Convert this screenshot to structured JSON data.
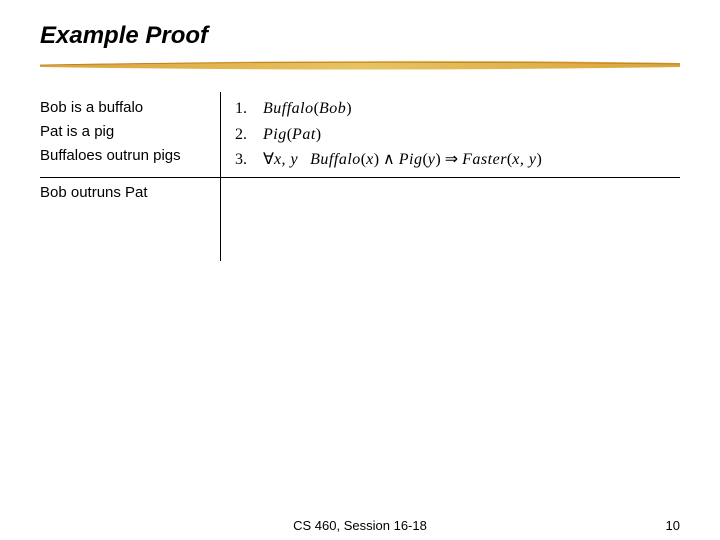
{
  "title": "Example Proof",
  "premises_text": [
    "Bob is a buffalo",
    "Pat is a pig",
    "Buffaloes outrun pigs"
  ],
  "conclusion_text": "Bob outruns Pat",
  "formal": {
    "line1_num": "1.",
    "line1_pred": "Buffalo",
    "line1_arg": "Bob",
    "line2_num": "2.",
    "line2_pred": "Pig",
    "line2_arg": "Pat",
    "line3_num": "3.",
    "line3_quant": "∀",
    "line3_vars": "x, y",
    "line3_p1": "Buffalo",
    "line3_a1": "x",
    "line3_conj": " ∧ ",
    "line3_p2": "Pig",
    "line3_a2": "y",
    "line3_impl": " ⇒ ",
    "line3_p3": "Faster",
    "line3_a3": "x, y"
  },
  "footer": {
    "center": "CS 460,  Session 16-18",
    "page": "10"
  }
}
